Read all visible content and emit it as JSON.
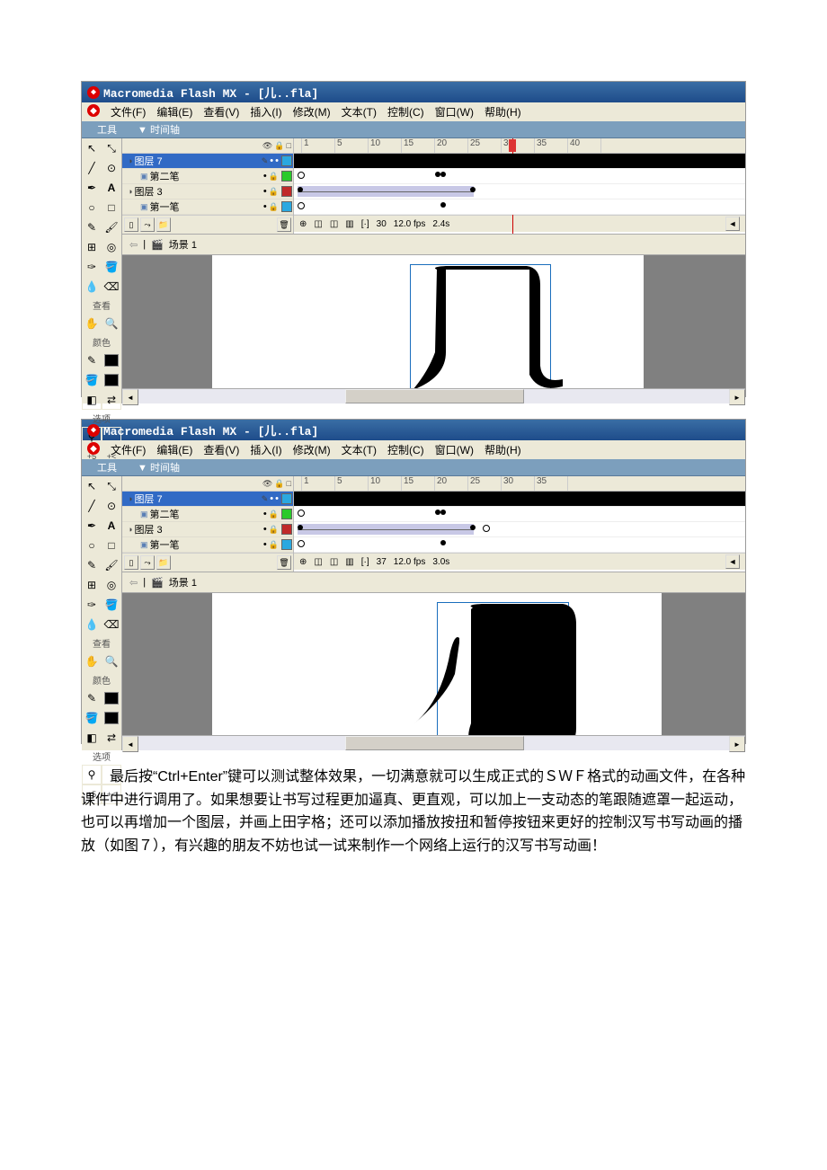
{
  "app": {
    "title": "Macromedia Flash MX - [儿..fla]"
  },
  "menu": {
    "file": "文件(F)",
    "edit": "编辑(E)",
    "view": "查看(V)",
    "insert": "插入(I)",
    "modify": "修改(M)",
    "text": "文本(T)",
    "control": "控制(C)",
    "window": "窗口(W)",
    "help": "帮助(H)"
  },
  "panels": {
    "tools": "工具",
    "timeline": "时间轴",
    "view_label": "查看",
    "colors_label": "颜色",
    "options_label": "选项"
  },
  "scene": {
    "label": "场景 1"
  },
  "zoom_plus": "+5",
  "zoom_minus": "+<",
  "screenshot1": {
    "playhead_frame": 30,
    "layers": [
      {
        "name": "图层 7",
        "selected": true,
        "swatch": "#2aa8e0"
      },
      {
        "name": "第二笔",
        "selected": false,
        "swatch": "#2aca2a"
      },
      {
        "name": "图层 3",
        "selected": false,
        "swatch": "#c02a2a"
      },
      {
        "name": "第一笔",
        "selected": false,
        "swatch": "#2aa8e0"
      }
    ],
    "ruler": [
      "1",
      "5",
      "10",
      "15",
      "20",
      "25",
      "30",
      "35",
      "40"
    ],
    "status": {
      "frame": "30",
      "fps": "12.0 fps",
      "time": "2.4s"
    }
  },
  "screenshot2": {
    "playhead_frame": 37,
    "layers": [
      {
        "name": "图层 7",
        "selected": true,
        "swatch": "#2aa8e0"
      },
      {
        "name": "第二笔",
        "selected": false,
        "swatch": "#2aca2a"
      },
      {
        "name": "图层 3",
        "selected": false,
        "swatch": "#c02a2a"
      },
      {
        "name": "第一笔",
        "selected": false,
        "swatch": "#2aa8e0"
      }
    ],
    "ruler": [
      "1",
      "5",
      "10",
      "15",
      "20",
      "25",
      "30",
      "35"
    ],
    "status": {
      "frame": "37",
      "fps": "12.0 fps",
      "time": "3.0s"
    }
  },
  "paragraph": "最后按“Ctrl+Enter”键可以测试整体效果，一切满意就可以生成正式的ＳＷＦ格式的动画文件，在各种课件中进行调用了。如果想要让书写过程更加逼真、更直观，可以加上一支动态的笔跟随遮罩一起运动，也可以再增加一个图层，并画上田字格；还可以添加播放按扭和暂停按钮来更好的控制汉写书写动画的播放（如图７），有兴趣的朋友不妨也试一试来制作一个网络上运行的汉写书写动画！"
}
